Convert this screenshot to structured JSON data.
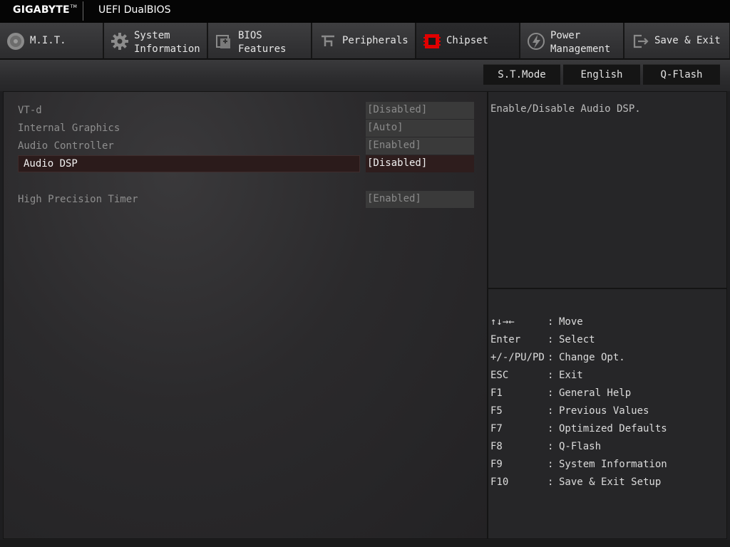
{
  "header": {
    "brand": "GIGABYTE",
    "brand_tm": "TM",
    "product": "UEFI DualBIOS"
  },
  "tabs": [
    {
      "label": "M.I.T.",
      "icon": "mit-disc-icon"
    },
    {
      "label": "System\nInformation",
      "icon": "gear-icon"
    },
    {
      "label": "BIOS\nFeatures",
      "icon": "bios-chip-icon"
    },
    {
      "label": "Peripherals",
      "icon": "usb-plug-icon"
    },
    {
      "label": "Chipset",
      "icon": "chipset-icon",
      "active": true
    },
    {
      "label": "Power\nManagement",
      "icon": "power-bolt-icon"
    },
    {
      "label": "Save & Exit",
      "icon": "exit-door-icon"
    }
  ],
  "toolbar": {
    "st_mode": "S.T.Mode",
    "language": "English",
    "qflash": "Q-Flash"
  },
  "settings": [
    {
      "label": "VT-d",
      "value": "[Disabled]"
    },
    {
      "label": "Internal Graphics",
      "value": "[Auto]"
    },
    {
      "label": "Audio Controller",
      "value": "[Enabled]"
    },
    {
      "label": "Audio DSP",
      "value": "[Disabled]",
      "selected": true
    },
    {
      "label": "High Precision Timer",
      "value": "[Enabled]"
    }
  ],
  "help": {
    "text": "Enable/Disable Audio DSP."
  },
  "keys": [
    {
      "key": "↑↓→←",
      "sep": ":",
      "desc": "Move"
    },
    {
      "key": "Enter",
      "sep": ":",
      "desc": "Select"
    },
    {
      "key": "+/-/PU/PD",
      "sep": ":",
      "desc": "Change Opt."
    },
    {
      "key": "ESC",
      "sep": ":",
      "desc": "Exit"
    },
    {
      "key": "F1",
      "sep": ":",
      "desc": "General Help"
    },
    {
      "key": "F5",
      "sep": ":",
      "desc": "Previous Values"
    },
    {
      "key": "F7",
      "sep": ":",
      "desc": "Optimized Defaults"
    },
    {
      "key": "F8",
      "sep": ":",
      "desc": "Q-Flash"
    },
    {
      "key": "F9",
      "sep": ":",
      "desc": "System Information"
    },
    {
      "key": "F10",
      "sep": ":",
      "desc": "Save & Exit Setup"
    }
  ],
  "colors": {
    "accent": "#e00000",
    "selected_row_bg": "#2b1b1b",
    "header_bg": "#050505"
  }
}
